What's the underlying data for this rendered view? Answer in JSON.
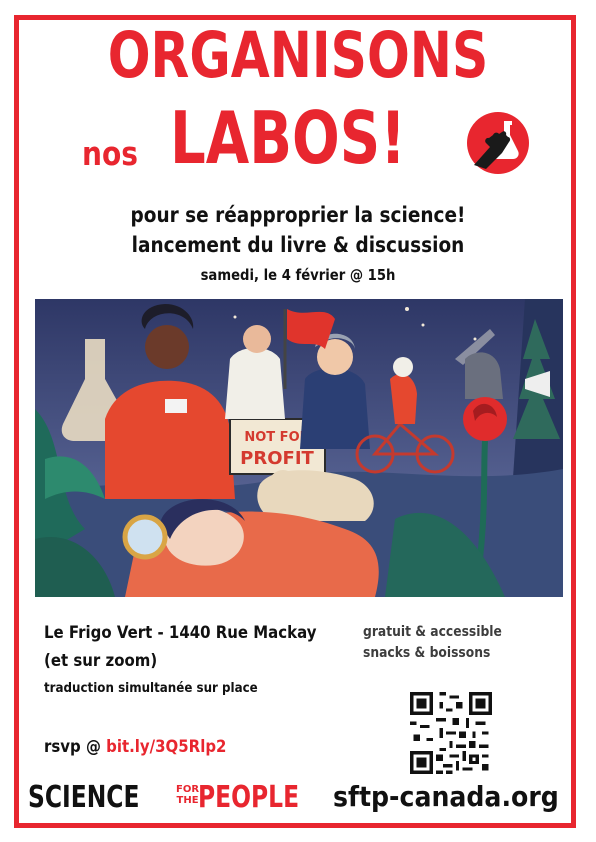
{
  "title": {
    "line1": "ORGANISONS",
    "line2_small": "nos",
    "line2_big": "LABOS!"
  },
  "subtitle": {
    "line1": "pour se réapproprier la science!",
    "line2": "lancement du livre & discussion",
    "date": "samedi, le 4 février @ 15h"
  },
  "illustration": {
    "sign_line1": "NOT FOR",
    "sign_line2": "PROFIT"
  },
  "venue": {
    "line1": "Le Frigo Vert - 1440 Rue Mackay",
    "line2": "(et sur zoom)",
    "line3": "traduction simultanée sur place"
  },
  "extras": {
    "line1": "gratuit & accessible",
    "line2": "snacks & boissons"
  },
  "rsvp": {
    "label": "rsvp @",
    "link": "bit.ly/3Q5Rlp2"
  },
  "brand": {
    "science": "SCIENCE",
    "for": "FOR",
    "the": "THE",
    "people": "PEOPLE",
    "url": "sftp-canada.org"
  },
  "colors": {
    "accent": "#e8262f",
    "text": "#111111",
    "illustration_bg": "#3c4a7a"
  }
}
